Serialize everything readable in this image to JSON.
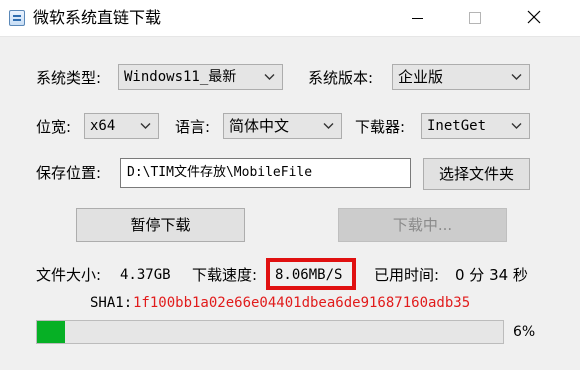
{
  "window": {
    "title": "微软系统直链下载"
  },
  "labels": {
    "system_type": "系统类型:",
    "system_edition": "系统版本:",
    "arch": "位宽:",
    "language": "语言:",
    "downloader": "下载器:",
    "save_location": "保存位置:"
  },
  "selects": {
    "system_type": "Windows11_最新",
    "system_edition": "企业版",
    "arch": "x64",
    "language": "简体中文",
    "downloader": "InetGet"
  },
  "save_path": "D:\\TIM文件存放\\MobileFile",
  "buttons": {
    "choose_folder": "选择文件夹",
    "pause": "暂停下载",
    "downloading": "下载中..."
  },
  "status": {
    "file_size_label": "文件大小:",
    "file_size_value": "4.37GB",
    "speed_label": "下载速度:",
    "speed_value": "8.06MB/S",
    "elapsed_label": "已用时间:",
    "elapsed_value": "0 分 34 秒",
    "sha1_label": "SHA1:",
    "sha1_value": "1f100bb1a02e66e04401dbea6de91687160adb35"
  },
  "progress": {
    "percent_value": 0.06,
    "percent_text": "6%"
  },
  "colors": {
    "progress_fill": "#06b025",
    "sha1": "#e11b1b",
    "highlight_box": "#e01010"
  },
  "icons": {
    "app": "app-window-icon",
    "minimize": "minimize-icon",
    "maximize": "maximize-icon",
    "close": "close-icon",
    "dropdown": "chevron-down-icon"
  }
}
